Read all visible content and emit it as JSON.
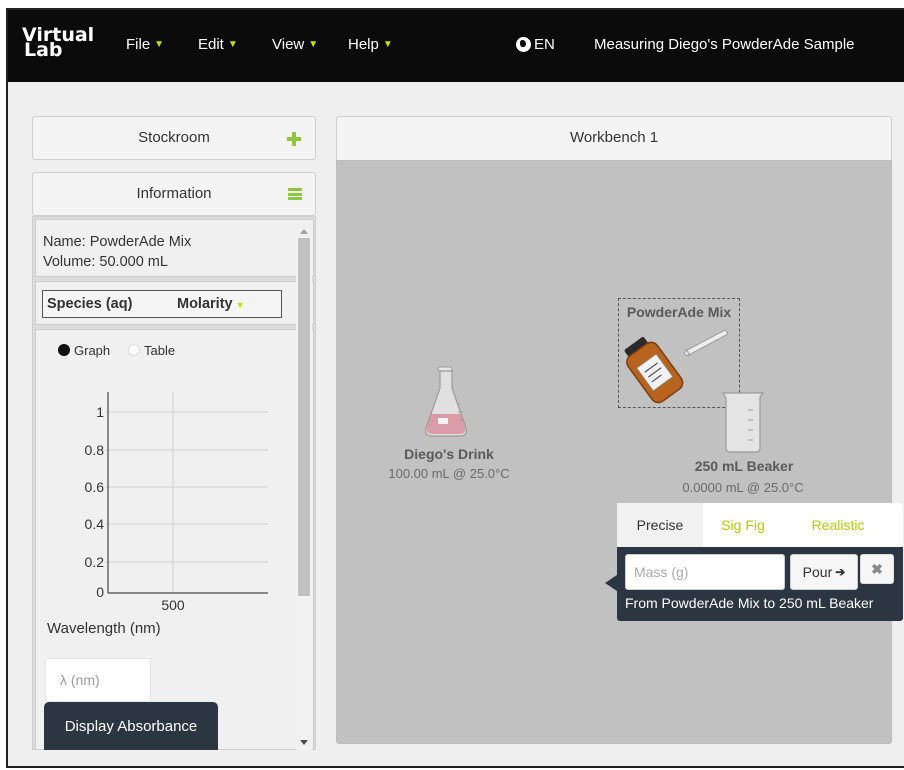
{
  "app": {
    "logo": [
      "Virtual",
      "Lab"
    ],
    "menu": [
      {
        "label": "File"
      },
      {
        "label": "Edit"
      },
      {
        "label": "View"
      },
      {
        "label": "Help"
      }
    ],
    "language": "EN",
    "title": "Measuring Diego's PowderAde Sample"
  },
  "stockroom": {
    "title": "Stockroom"
  },
  "information": {
    "title": "Information",
    "name_line": "Name: PowderAde Mix",
    "volume_line": "Volume: 50.000 mL",
    "species_header": "Species (aq)",
    "molarity_header": "Molarity",
    "view_options": [
      {
        "label": "Graph",
        "selected": true
      },
      {
        "label": "Table",
        "selected": false
      }
    ],
    "graph": {
      "y_ticks": [
        "1",
        "0.8",
        "0.6",
        "0.4",
        "0.2",
        "0"
      ],
      "x_ticks": [
        "500"
      ],
      "xlabel": "Wavelength (nm)"
    },
    "lambda_placeholder": "λ (nm)",
    "display_button": "Display Absorbance"
  },
  "workbench": {
    "title": "Workbench 1",
    "items": [
      {
        "label": "Diego's Drink",
        "sub": "100.00 mL @ 25.0°C"
      },
      {
        "label": "PowderAde Mix",
        "sub": ""
      },
      {
        "label": "250 mL Beaker",
        "sub": "0.0000 mL @ 25.0°C"
      }
    ]
  },
  "pour_popover": {
    "tabs": [
      {
        "label": "Precise",
        "active": true
      },
      {
        "label": "Sig Fig",
        "active": false
      },
      {
        "label": "Realistic",
        "active": false
      }
    ],
    "mass_placeholder": "Mass (g)",
    "pour_label": "Pour",
    "close_symbol": "✖",
    "transfer_text": "From PowderAde Mix to 250 mL Beaker"
  },
  "colors": {
    "navbar": "#0b0b0b",
    "accent": "#8dc63f",
    "caret": "#c6e000",
    "popover": "#2b3642",
    "workbench": "#c1c1c1"
  }
}
